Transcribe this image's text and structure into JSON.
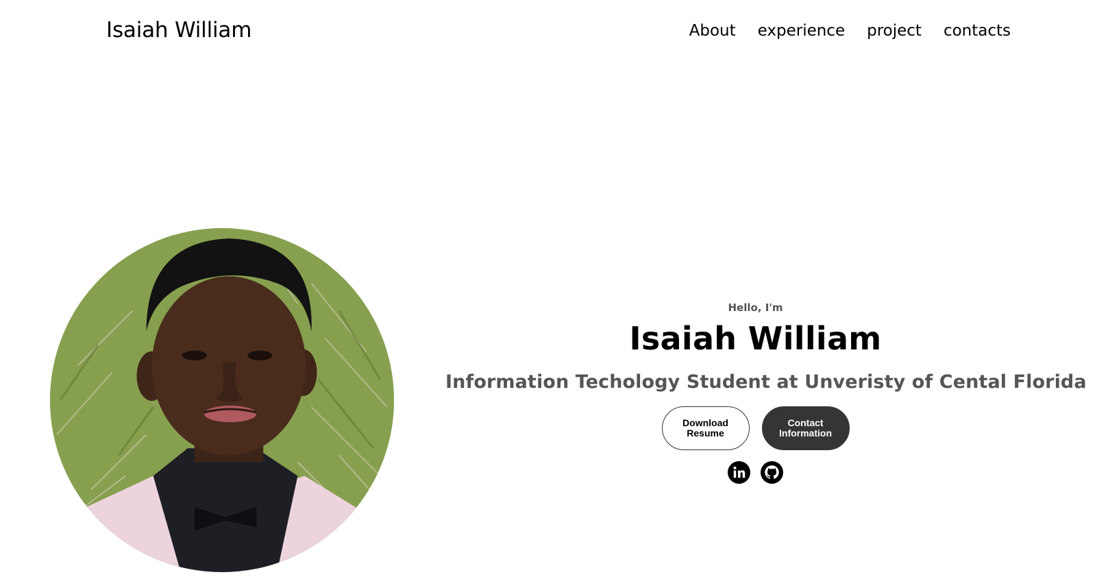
{
  "header": {
    "logo": "Isaiah William",
    "nav": [
      {
        "label": "About"
      },
      {
        "label": "experience"
      },
      {
        "label": "project"
      },
      {
        "label": "contacts"
      }
    ]
  },
  "hero": {
    "greeting": "Hello, I'm",
    "name": "Isaiah William",
    "subtitle": "Information Techology Student at Unveristy of Cental Florida",
    "buttons": {
      "download": "Download Resume",
      "contact": "Contact Information"
    },
    "social_icons": [
      "linkedin-icon",
      "github-icon"
    ]
  },
  "colors": {
    "text": "#000000",
    "muted": "#555555",
    "dark_button": "#353535"
  }
}
